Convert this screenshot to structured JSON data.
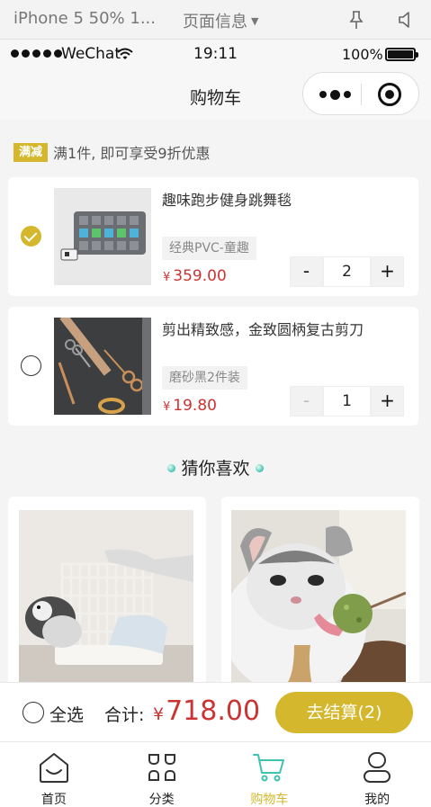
{
  "simulator": {
    "device": "iPhone 5 50% 1...",
    "page_info": "页面信息",
    "pin_icon": "pin-icon",
    "sound_icon": "sound-icon"
  },
  "status_bar": {
    "carrier": "WeChat",
    "time": "19:11",
    "battery": "100%"
  },
  "navbar": {
    "title": "购物车"
  },
  "promo": {
    "badge": "满减",
    "text": "满1件, 即可享受9折优惠"
  },
  "cart": {
    "items": [
      {
        "name": "趣味跑步健身跳舞毯",
        "sku": "经典PVC-童趣",
        "currency": "¥",
        "price": "359.00",
        "qty": "2",
        "checked": true,
        "minus": "-",
        "plus": "+"
      },
      {
        "name": "剪出精致感，金致圆柄复古剪刀",
        "sku": "磨砂黑2件装",
        "currency": "¥",
        "price": "19.80",
        "qty": "1",
        "checked": false,
        "minus": "-",
        "plus": "+"
      }
    ]
  },
  "guess": {
    "title": "猜你喜欢"
  },
  "bottom_bar": {
    "select_all": "全选",
    "total_label": "合计:",
    "currency": "¥",
    "total": "718.00",
    "checkout": "去结算(2)"
  },
  "tabbar": {
    "tabs": [
      {
        "label": "首页",
        "icon": "home-icon",
        "active": false
      },
      {
        "label": "分类",
        "icon": "category-icon",
        "active": false
      },
      {
        "label": "购物车",
        "icon": "cart-icon",
        "active": true
      },
      {
        "label": "我的",
        "icon": "user-icon",
        "active": false
      }
    ]
  },
  "colors": {
    "accent": "#d4b72c",
    "price": "#cc3333",
    "active_tab_icon": "#3ec3b0"
  }
}
